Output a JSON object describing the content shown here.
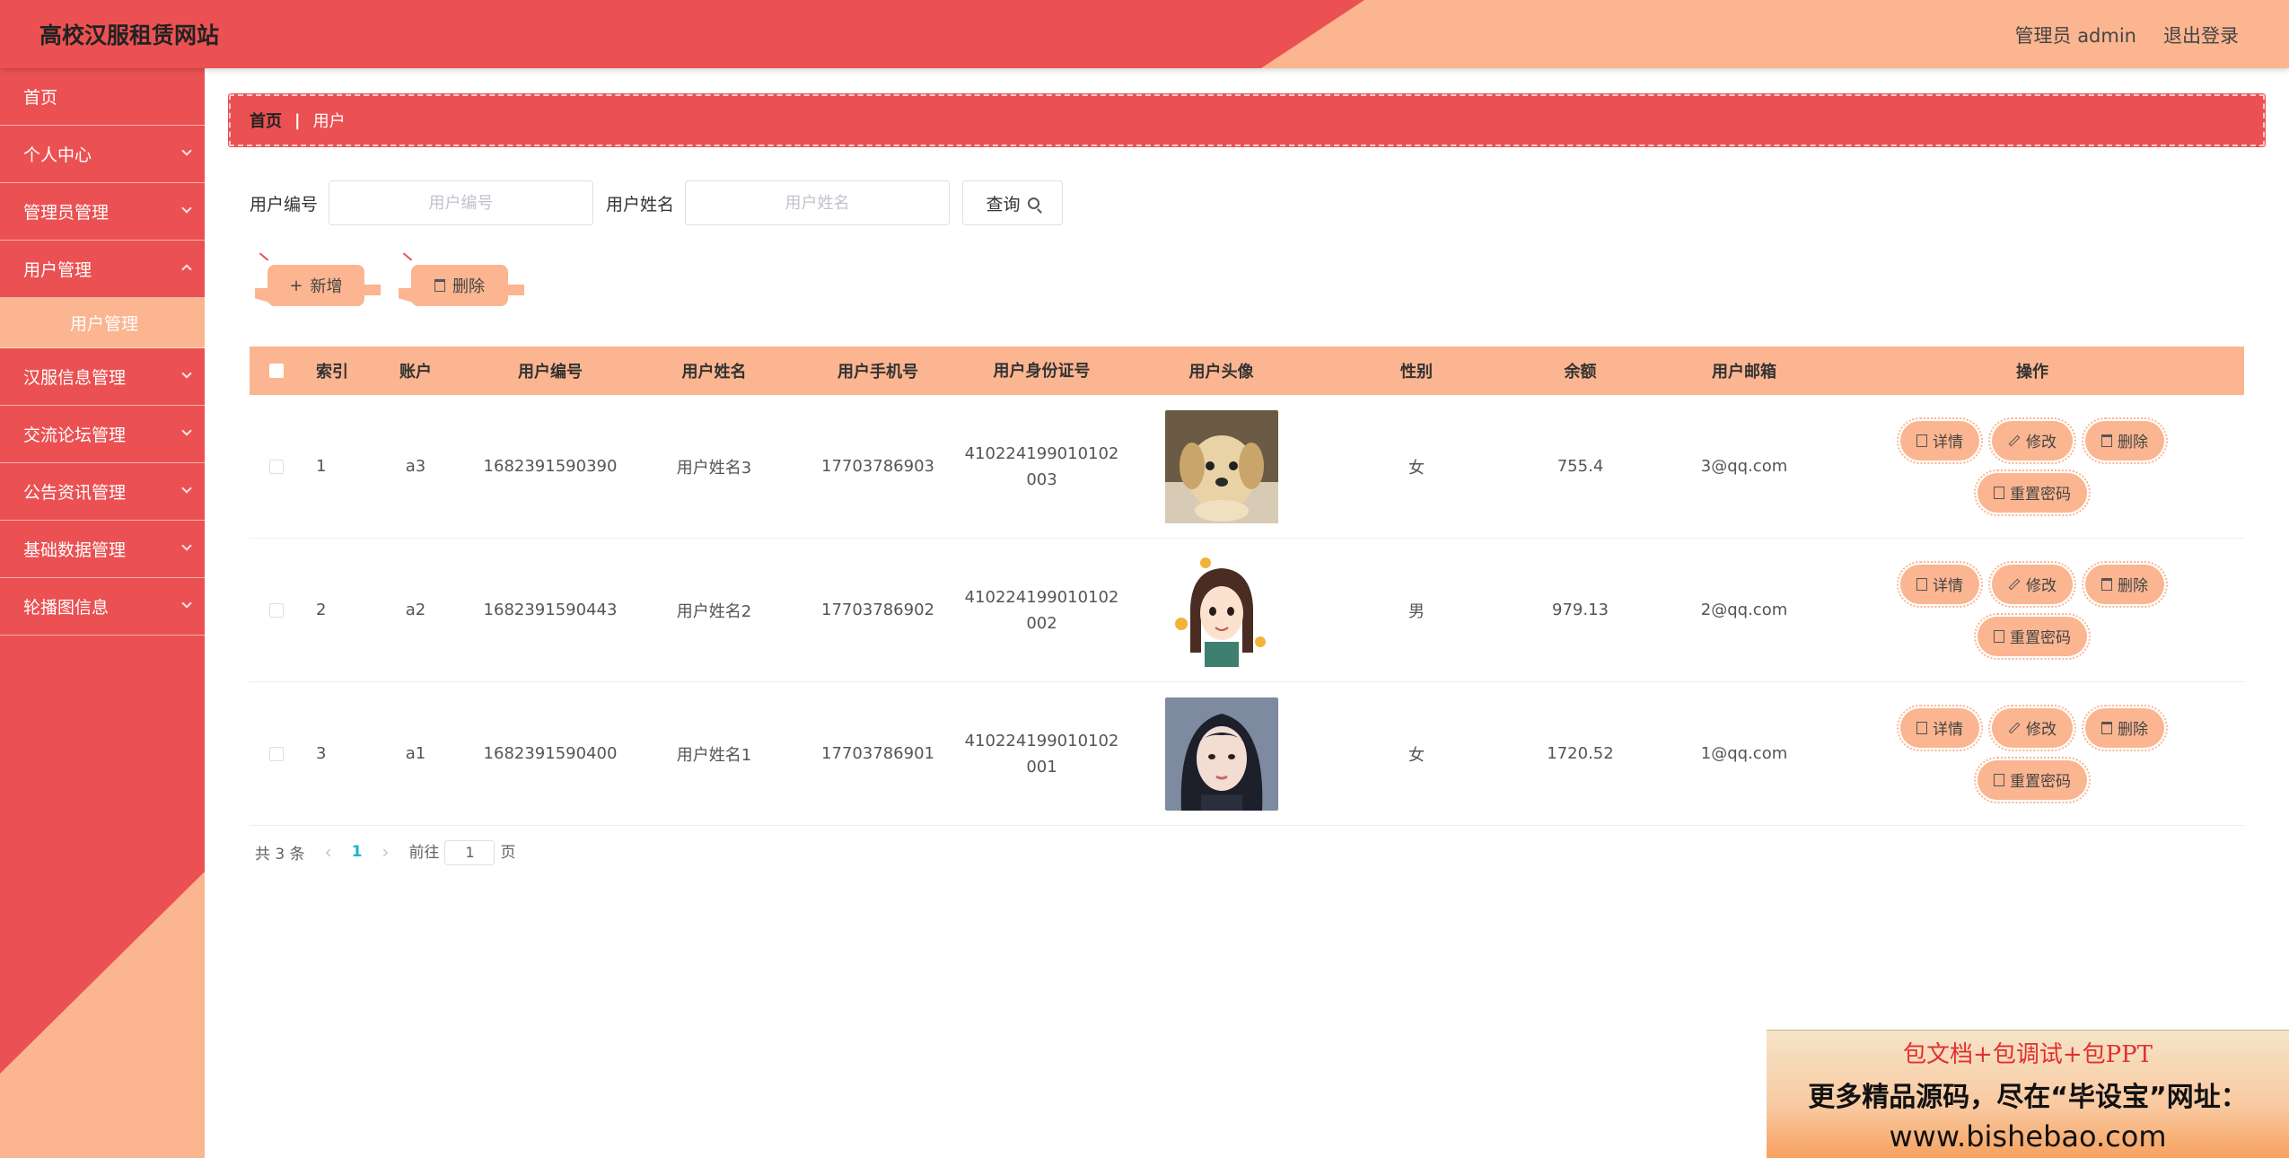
{
  "app": {
    "title": "高校汉服租赁网站",
    "admin_label": "管理员 admin",
    "logout_label": "退出登录"
  },
  "sidebar": {
    "items": [
      {
        "label": "首页",
        "has_children": false
      },
      {
        "label": "个人中心",
        "has_children": true
      },
      {
        "label": "管理员管理",
        "has_children": true
      },
      {
        "label": "用户管理",
        "has_children": true,
        "open": true
      },
      {
        "label": "汉服信息管理",
        "has_children": true
      },
      {
        "label": "交流论坛管理",
        "has_children": true
      },
      {
        "label": "公告资讯管理",
        "has_children": true
      },
      {
        "label": "基础数据管理",
        "has_children": true
      },
      {
        "label": "轮播图信息",
        "has_children": true
      }
    ],
    "submenu_active": "用户管理"
  },
  "breadcrumb": {
    "home": "首页",
    "separator": "|",
    "current": "用户"
  },
  "search": {
    "user_no_label": "用户编号",
    "user_no_placeholder": "用户编号",
    "user_name_label": "用户姓名",
    "user_name_placeholder": "用户姓名",
    "query_label": "查询"
  },
  "actions": {
    "add_label": "新增",
    "delete_label": "删除"
  },
  "table": {
    "columns": [
      "索引",
      "账户",
      "用户编号",
      "用户姓名",
      "用户手机号",
      "用户身份证号",
      "用户头像",
      "性别",
      "余额",
      "用户邮箱",
      "操作"
    ],
    "rows": [
      {
        "index": "1",
        "account": "a3",
        "user_no": "1682391590390",
        "name": "用户姓名3",
        "phone": "17703786903",
        "id_line1": "410224199010102",
        "id_line2": "003",
        "avatar": "puppy-photo",
        "sex": "女",
        "balance": "755.4",
        "email": "3@qq.com"
      },
      {
        "index": "2",
        "account": "a2",
        "user_no": "1682391590443",
        "name": "用户姓名2",
        "phone": "17703786902",
        "id_line1": "410224199010102",
        "id_line2": "002",
        "avatar": "cartoon-girl",
        "sex": "男",
        "balance": "979.13",
        "email": "2@qq.com"
      },
      {
        "index": "3",
        "account": "a1",
        "user_no": "1682391590400",
        "name": "用户姓名1",
        "phone": "17703786901",
        "id_line1": "410224199010102",
        "id_line2": "001",
        "avatar": "girl-photo",
        "sex": "女",
        "balance": "1720.52",
        "email": "1@qq.com"
      }
    ],
    "ops": {
      "detail": "详情",
      "edit": "修改",
      "delete": "删除",
      "reset_password": "重置密码"
    }
  },
  "pagination": {
    "total": "共 3 条",
    "prev": "‹",
    "current_page": "1",
    "next": "›",
    "goto_label": "前往",
    "goto_value": "1",
    "page_suffix": "页"
  },
  "promo": {
    "line1": "包文档+包调试+包PPT",
    "line2": "更多精品源码，尽在“毕设宝”网址：",
    "line3": "www.bishebao.com"
  },
  "colors": {
    "primary_red": "#EB5152",
    "peach": "#FBB590",
    "page_active": "#1cb4c6"
  }
}
